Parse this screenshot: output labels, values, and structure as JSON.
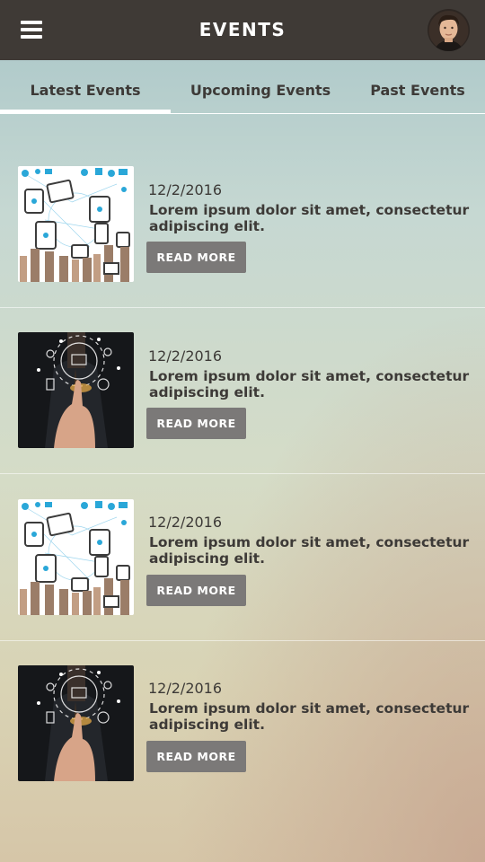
{
  "header": {
    "title": "EVENTS",
    "menu_icon": "hamburger-icon",
    "avatar": "user-avatar"
  },
  "tabs": [
    {
      "label": "Latest Events",
      "active": true
    },
    {
      "label": "Upcoming Events",
      "active": false
    },
    {
      "label": "Past Events",
      "active": false
    }
  ],
  "events": [
    {
      "date": "12/2/2016",
      "description": "Lorem ipsum dolor sit amet, consectetur adipiscing elit.",
      "button": "READ MORE",
      "image": "devices-hands-illustration"
    },
    {
      "date": "12/2/2016",
      "description": "Lorem ipsum dolor sit amet, consectetur adipiscing elit.",
      "button": "READ MORE",
      "image": "touchscreen-businessman-photo"
    },
    {
      "date": "12/2/2016",
      "description": "Lorem ipsum dolor sit amet, consectetur adipiscing elit.",
      "button": "READ MORE",
      "image": "devices-hands-illustration"
    },
    {
      "date": "12/2/2016",
      "description": "Lorem ipsum dolor sit amet, consectetur adipiscing elit.",
      "button": "READ MORE",
      "image": "touchscreen-businessman-photo"
    }
  ],
  "colors": {
    "header_bg": "#3f3a36",
    "button_bg": "#7b7978",
    "text": "#3d3a37",
    "accent_blue": "#2aa7d8"
  }
}
